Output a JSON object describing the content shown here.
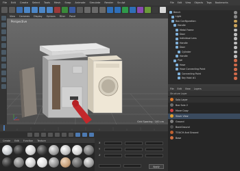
{
  "app": {
    "menu": [
      "File",
      "Edit",
      "Create",
      "Select",
      "Tools",
      "Mesh",
      "Snap",
      "Animate",
      "Simulate",
      "Render",
      "Sculpt",
      "Motion Tracker",
      "MoGraph",
      "Character",
      "Pipeline",
      "Plugins",
      "Script",
      "Window",
      "Help"
    ]
  },
  "viewport": {
    "menu": [
      "View",
      "Cameras",
      "Display",
      "Options",
      "Filter",
      "Panel"
    ],
    "label": "Perspective",
    "grid_spacing": "Grid Spacing : 100 cm"
  },
  "object_manager": {
    "tabs": [
      "File",
      "Edit",
      "View",
      "Objects",
      "Tags",
      "Bookmarks"
    ],
    "menu": [
      "Objects",
      "Takes",
      "Content Browser",
      "Structure"
    ],
    "items": [
      {
        "label": "Bench",
        "tag_color": "#8a8a8a"
      },
      {
        "label": "Light",
        "tag_color": "#8a8a8a"
      },
      {
        "label": "Box Configuration",
        "tag_color": "#c9a25a"
      },
      {
        "label": "Handle",
        "tag_color": "#c9a25a"
      },
      {
        "label": "Metal Frame",
        "tag_color": "#bdbdbd"
      },
      {
        "label": "Door",
        "tag_color": "#bdbdbd"
      },
      {
        "label": "Individual Lens",
        "tag_color": "#bdbdbd"
      },
      {
        "label": "Handle",
        "tag_color": "#bdbdbd"
      },
      {
        "label": "Door",
        "tag_color": "#bdbdbd"
      },
      {
        "label": "Cylinder",
        "tag_color": "#bdbdbd"
      },
      {
        "label": "Handle",
        "tag_color": "#bdbdbd"
      },
      {
        "label": "Pipe",
        "tag_color": "#d06a4a"
      },
      {
        "label": "Hose",
        "tag_color": "#d06a4a"
      },
      {
        "label": "Hose Connecting Point",
        "tag_color": "#d06a4a"
      },
      {
        "label": "Connecting Point",
        "tag_color": "#d06a4a"
      },
      {
        "label": "Key Hold #1",
        "tag_color": "#d06a4a"
      }
    ]
  },
  "layer_manager": {
    "tabs": [
      "File",
      "Edit",
      "View",
      "Layers"
    ],
    "menu": [
      "Structure",
      "Layers"
    ],
    "title": "Structure Layer",
    "items": [
      {
        "label": "Solo Layer",
        "color": "#e07a2a"
      },
      {
        "label": "Box Solo 2",
        "color": "#6e6e6e"
      },
      {
        "label": "Move Copy",
        "color": "#d04040"
      },
      {
        "label": "Stack View",
        "color": "#e0a030"
      },
      {
        "label": "Ground",
        "color": "#808080"
      },
      {
        "label": "BackGround",
        "color": "#505050"
      },
      {
        "label": "TOUCH And Ground",
        "color": "#c06030"
      },
      {
        "label": "Base",
        "color": "#d07040"
      }
    ]
  },
  "materials": {
    "menu": [
      "Create",
      "Edit",
      "Function",
      "Texture"
    ],
    "spheres": [
      {
        "color": "#bfc3c7"
      },
      {
        "color": "#2d2d2d"
      },
      {
        "color": "#d0d0d0"
      },
      {
        "color": "#3a3a3a"
      },
      {
        "color": "#9a9a9a"
      },
      {
        "color": "#bcbcbc"
      },
      {
        "color": "#cfcfcf"
      },
      {
        "color": "#6f6f6f"
      },
      {
        "color": "#2f2f2f"
      },
      {
        "color": "#7b7b7b"
      },
      {
        "color": "#cccccc"
      },
      {
        "color": "#dddddd"
      },
      {
        "color": "#8a8a8a"
      },
      {
        "color": "#c7a07a"
      },
      {
        "color": "#5e5e5e"
      },
      {
        "color": "#9b9b9b"
      }
    ]
  },
  "coordinates": {
    "rows": [
      {
        "axis": "X",
        "pos": "0 cm",
        "size": "0 cm",
        "rot": "0°"
      },
      {
        "axis": "Y",
        "pos": "0 cm",
        "size": "0 cm",
        "rot": "0°"
      },
      {
        "axis": "Z",
        "pos": "0 cm",
        "size": "0 cm",
        "rot": "0°"
      }
    ],
    "mode_object": "Object (Rel)",
    "mode_size": "Size",
    "apply": "Apply"
  },
  "accent": "#4d7ab2"
}
